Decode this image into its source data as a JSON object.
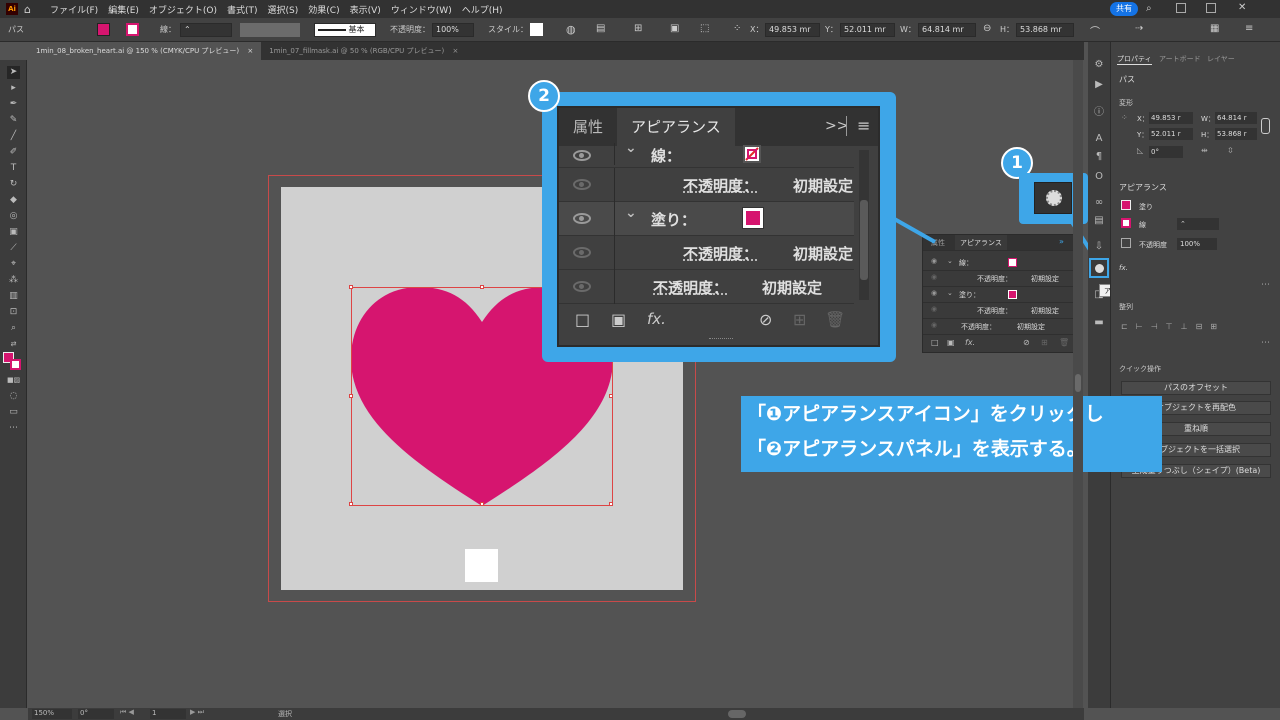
{
  "menubar": {
    "logo": "Ai",
    "items": [
      "ファイル(F)",
      "編集(E)",
      "オブジェクト(O)",
      "書式(T)",
      "選択(S)",
      "効果(C)",
      "表示(V)",
      "ウィンドウ(W)",
      "ヘルプ(H)"
    ],
    "share": "共有"
  },
  "control": {
    "object_type": "パス",
    "stroke_label": "線：",
    "stroke_profile": "基本",
    "opacity_label": "不透明度：",
    "opacity_value": "100%",
    "style_label": "スタイル：",
    "x_label": "X：",
    "x_value": "49.853 mr",
    "y_label": "Y：",
    "y_value": "52.011 mr",
    "w_label": "W：",
    "w_value": "64.814 mr",
    "h_label": "H：",
    "h_value": "53.868 mr"
  },
  "tabs": [
    {
      "label": "1min_08_broken_heart.ai @ 150 % (CMYK/CPU プレビュー)",
      "close": "×"
    },
    {
      "label": "1min_07_fillmask.ai @ 50 % (RGB/CPU プレビュー)",
      "close": "×"
    }
  ],
  "colors": {
    "fill": "#d6156f",
    "accent": "#3ea6e8"
  },
  "appearance_small": {
    "tab_attr": "属性",
    "tab_appearance": "アピアランス",
    "stroke": "線：",
    "opacity": "不透明度：",
    "default": "初期設定",
    "fill": "塗り：",
    "fx": "fx."
  },
  "appearance_big": {
    "tab_attr": "属性",
    "tab_appearance": "アピアランス",
    "menu": ">>",
    "stroke": "線：",
    "opacity": "不透明度：",
    "default": "初期設定",
    "fill": "塗り：",
    "fx": "fx."
  },
  "tooltip": "アピアランス",
  "callouts": {
    "num1": "1",
    "num2": "2",
    "line1": "「❶アピアランスアイコン」をクリックし",
    "line2": "「❷アピアランスパネル」を表示する。"
  },
  "properties": {
    "tabs": [
      "プロパティ",
      "アートボード",
      "レイヤー"
    ],
    "object": "パス",
    "transform_title": "変形",
    "x_label": "X：",
    "x_value": "49.853 r",
    "w_label": "W：",
    "w_value": "64.814 r",
    "y_label": "Y：",
    "y_value": "52.011 r",
    "h_label": "H：",
    "h_value": "53.868 r",
    "angle": "0°",
    "appearance_title": "アピアランス",
    "fill": "塗り",
    "stroke": "線",
    "opacity": "不透明度",
    "opacity_value": "100%",
    "fx": "fx.",
    "align_title": "整列",
    "quick_title": "クイック操作",
    "btn1": "パスのオフセット",
    "btn2": "オブジェクトを再配色",
    "btn3": "重ね順",
    "btn4": "オブジェクトを一括選択",
    "btn5": "生成塗りつぶし（シェイプ）(Beta)"
  },
  "status": {
    "zoom": "150%",
    "angle": "0°",
    "page": "1",
    "mode": "選択"
  }
}
